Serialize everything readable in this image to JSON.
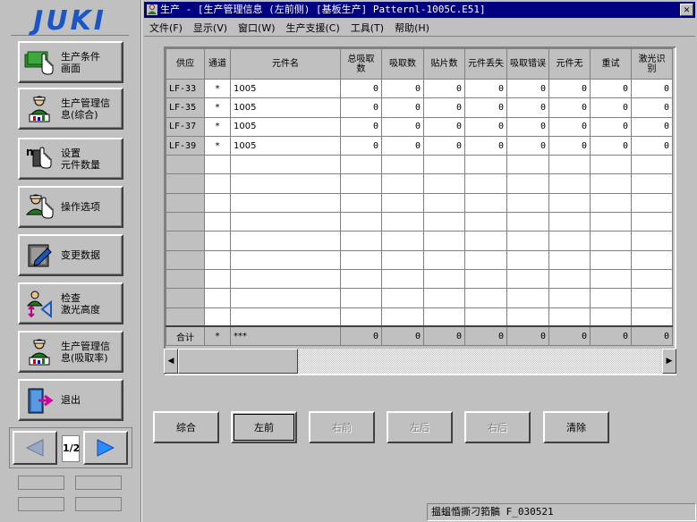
{
  "logo": "JUKI",
  "sidebar": {
    "items": [
      {
        "label": "生产条件\n画面",
        "icon": "money-stack-hand-icon"
      },
      {
        "label": "生产管理信\n息(综合)",
        "icon": "operator-chart-icon"
      },
      {
        "label": "设置\n元件数量",
        "icon": "reel-count-hand-icon"
      },
      {
        "label": "操作选项",
        "icon": "operator-hand-icon"
      },
      {
        "label": "变更数据",
        "icon": "edit-document-icon"
      },
      {
        "label": "检查\n激光高度",
        "icon": "laser-height-check-icon"
      },
      {
        "label": "生产管理信\n息(吸取率)",
        "icon": "operator-pickup-rate-icon"
      },
      {
        "label": "退出",
        "icon": "exit-door-icon"
      }
    ],
    "pager": {
      "page": "1/2"
    }
  },
  "window": {
    "title": "生产 - [生产管理信息 (左前侧) [基板生产] Patternl-1005C.E51]",
    "menu": [
      "文件(F)",
      "显示(V)",
      "窗口(W)",
      "生产支援(C)",
      "工具(T)",
      "帮助(H)"
    ]
  },
  "grid": {
    "columns": [
      "供应",
      "通道",
      "元件名",
      "总吸取数",
      "吸取数",
      "贴片数",
      "元件丢失",
      "吸取错误",
      "元件无",
      "重试",
      "激光识别"
    ],
    "rows": [
      [
        "LF-33",
        "*",
        "1005",
        "0",
        "0",
        "0",
        "0",
        "0",
        "0",
        "0",
        "0"
      ],
      [
        "LF-35",
        "*",
        "1005",
        "0",
        "0",
        "0",
        "0",
        "0",
        "0",
        "0",
        "0"
      ],
      [
        "LF-37",
        "*",
        "1005",
        "0",
        "0",
        "0",
        "0",
        "0",
        "0",
        "0",
        "0"
      ],
      [
        "LF-39",
        "*",
        "1005",
        "0",
        "0",
        "0",
        "0",
        "0",
        "0",
        "0",
        "0"
      ]
    ],
    "empty_rows": 9,
    "total": [
      "合计",
      "*",
      "***",
      "0",
      "0",
      "0",
      "0",
      "0",
      "0",
      "0",
      "0"
    ]
  },
  "actions": [
    {
      "label": "综合",
      "state": "enabled"
    },
    {
      "label": "左前",
      "state": "pressed"
    },
    {
      "label": "右前",
      "state": "disabled"
    },
    {
      "label": "左后",
      "state": "disabled"
    },
    {
      "label": "右后",
      "state": "disabled"
    },
    {
      "label": "清除",
      "state": "enabled"
    }
  ],
  "status": "揾蝹惛撕刁筘髇  F_030521"
}
